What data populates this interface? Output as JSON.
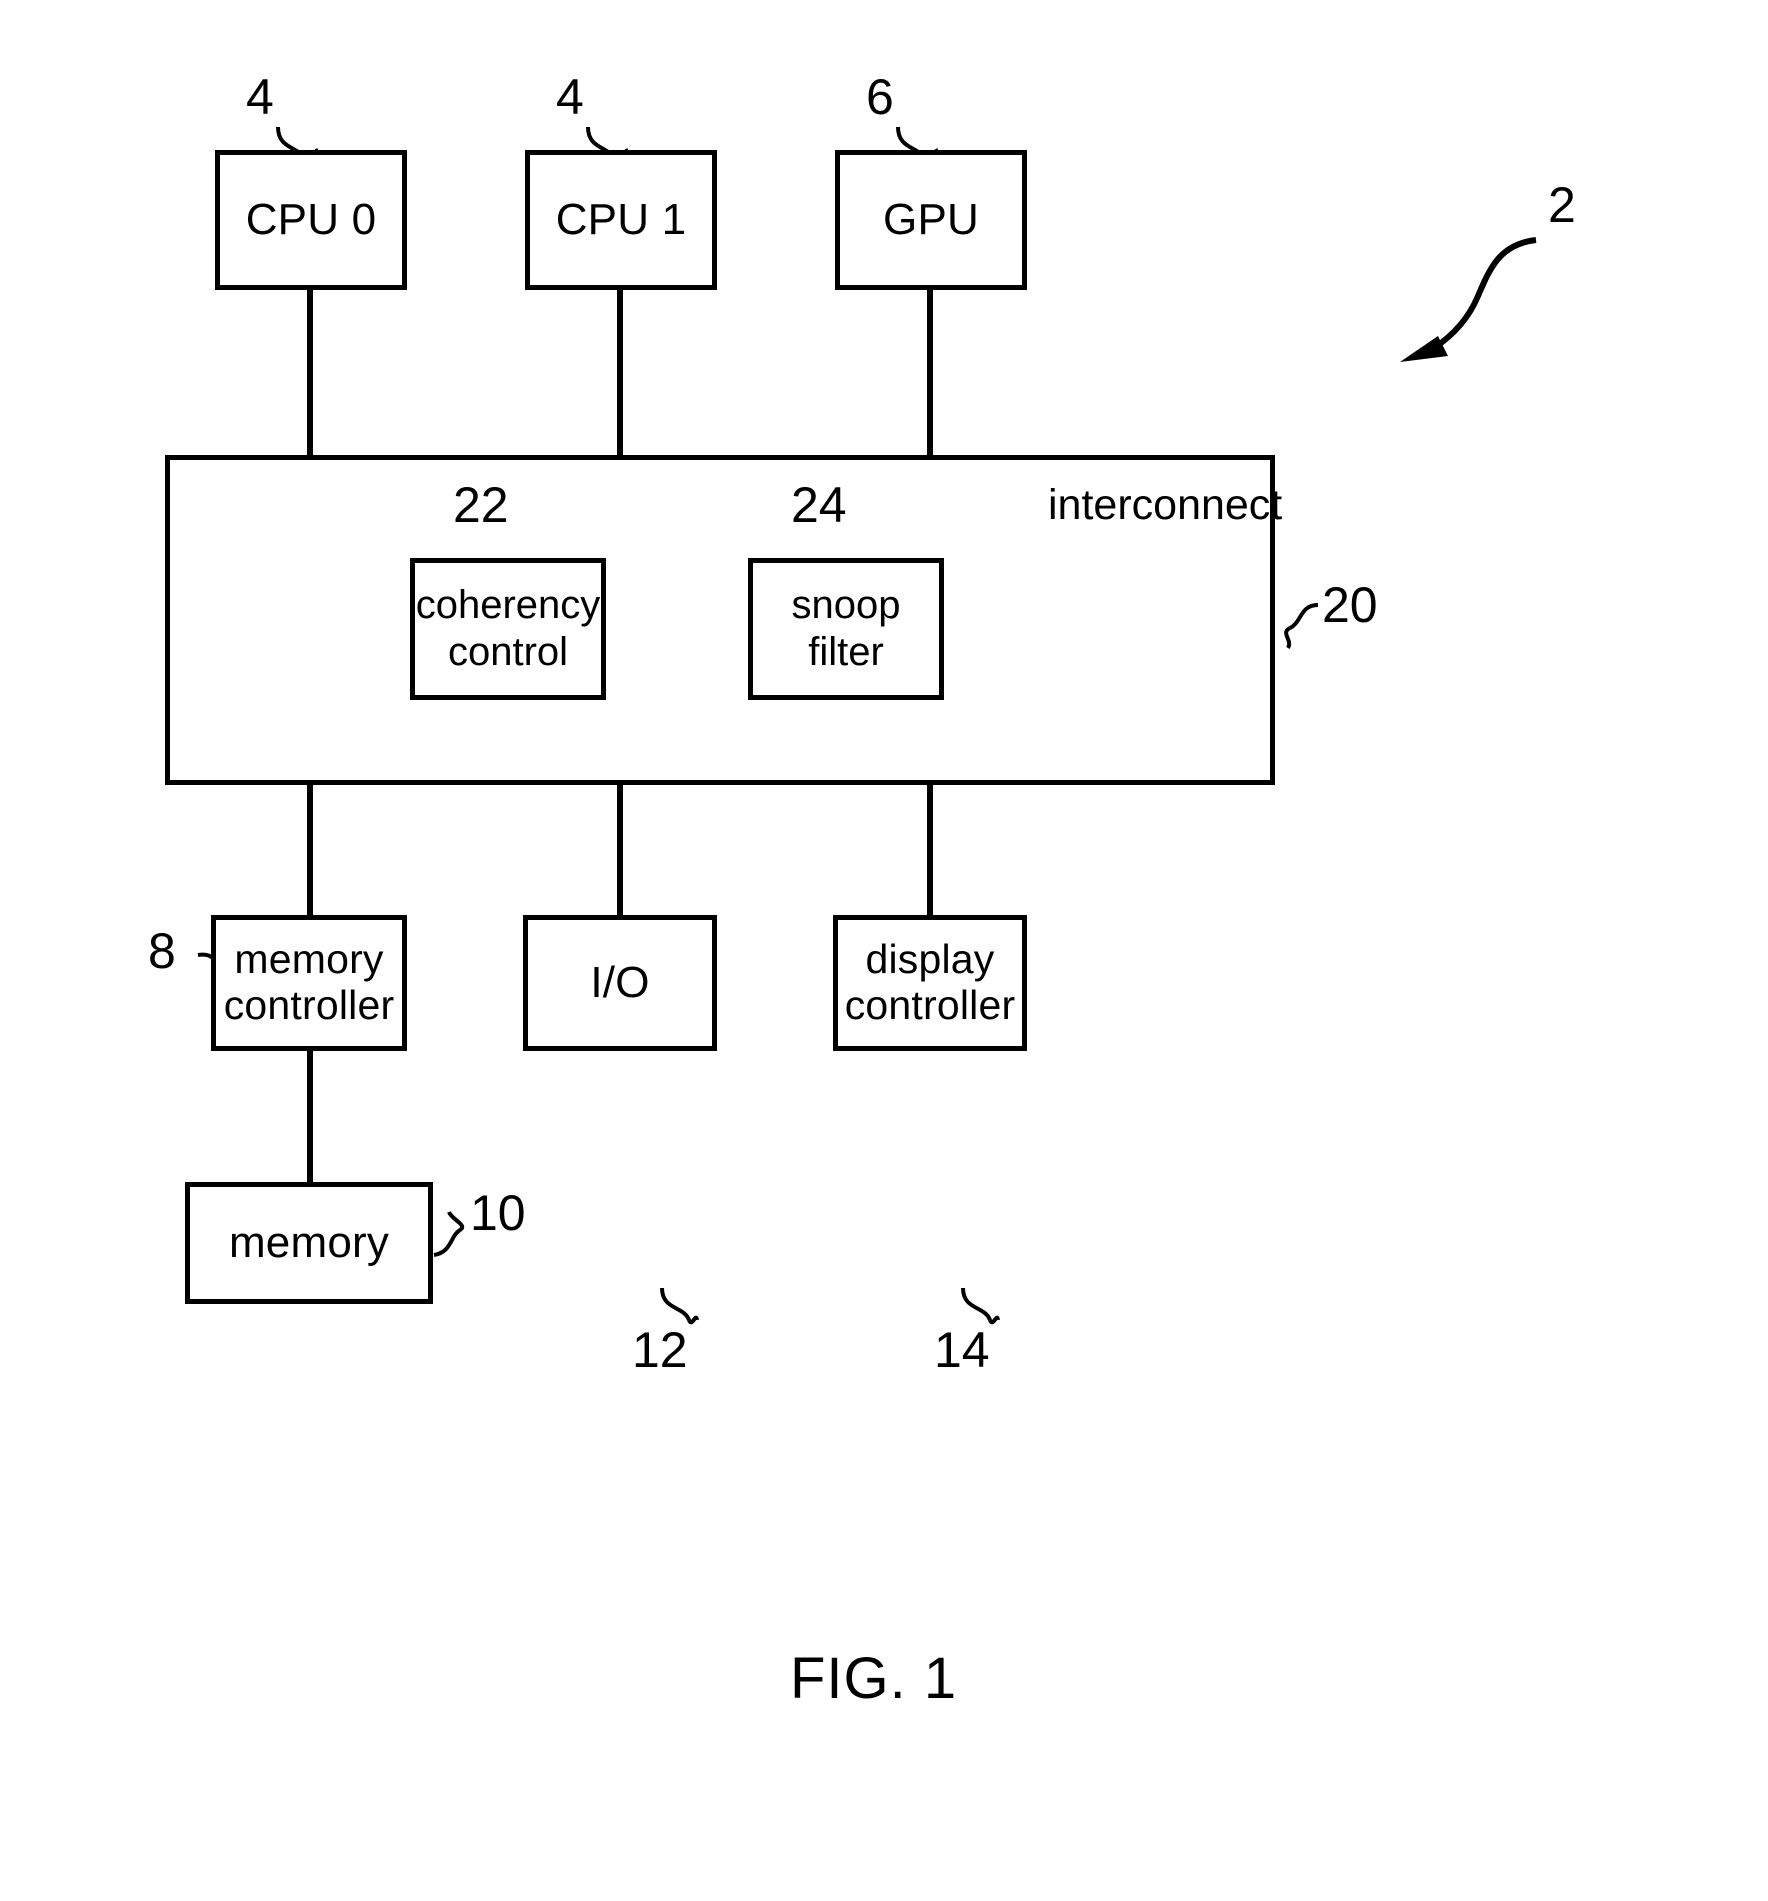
{
  "figure": {
    "caption": "FIG. 1",
    "system_ref": "2"
  },
  "nodes": {
    "cpu0": {
      "label": "CPU 0",
      "ref": "4"
    },
    "cpu1": {
      "label": "CPU 1",
      "ref": "4"
    },
    "gpu": {
      "label": "GPU",
      "ref": "6"
    },
    "interconnect": {
      "label": "interconnect",
      "ref": "20"
    },
    "coherency_control": {
      "label": "coherency\ncontrol",
      "ref": "22"
    },
    "snoop_filter": {
      "label": "snoop\nfilter",
      "ref": "24"
    },
    "memory_controller": {
      "label": "memory\ncontroller",
      "ref": "8"
    },
    "io": {
      "label": "I/O",
      "ref": "12"
    },
    "display_controller": {
      "label": "display\ncontroller",
      "ref": "14"
    },
    "memory": {
      "label": "memory",
      "ref": "10"
    }
  },
  "style": {
    "line_color": "#000000",
    "background": "#ffffff"
  }
}
